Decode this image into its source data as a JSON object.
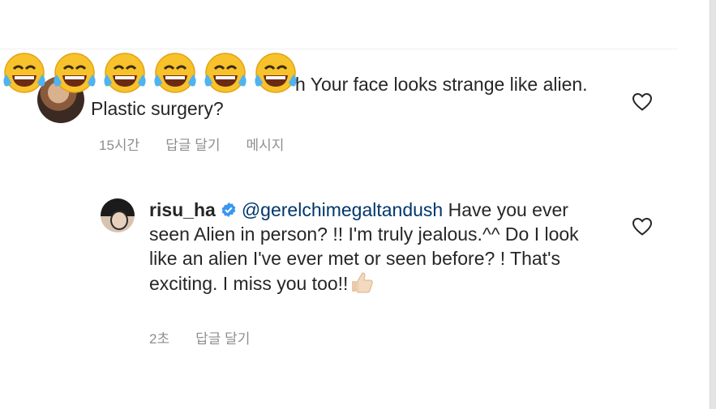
{
  "comment1": {
    "text_visible_end": "h Your face looks strange like alien. Plastic surgery?",
    "time": "15시간",
    "reply_label": "답글 달기",
    "message_label": "메시지"
  },
  "comment2": {
    "username": "risu_ha",
    "mention": "@gerelchimegaltandush",
    "text": " Have you ever seen Alien in person? !! I'm truly jealous.^^ Do I look like an alien I've ever met or seen before? ! That's exciting. I miss you too!!",
    "time": "2초",
    "reply_label": "답글 달기"
  },
  "colors": {
    "text": "#262626",
    "meta": "#8e8e8e",
    "mention": "#00376b",
    "verified": "#3897f0"
  },
  "icons": [
    "laughing-crying-emoji",
    "heart-icon",
    "verified-badge-icon",
    "thumbs-up-emoji"
  ]
}
